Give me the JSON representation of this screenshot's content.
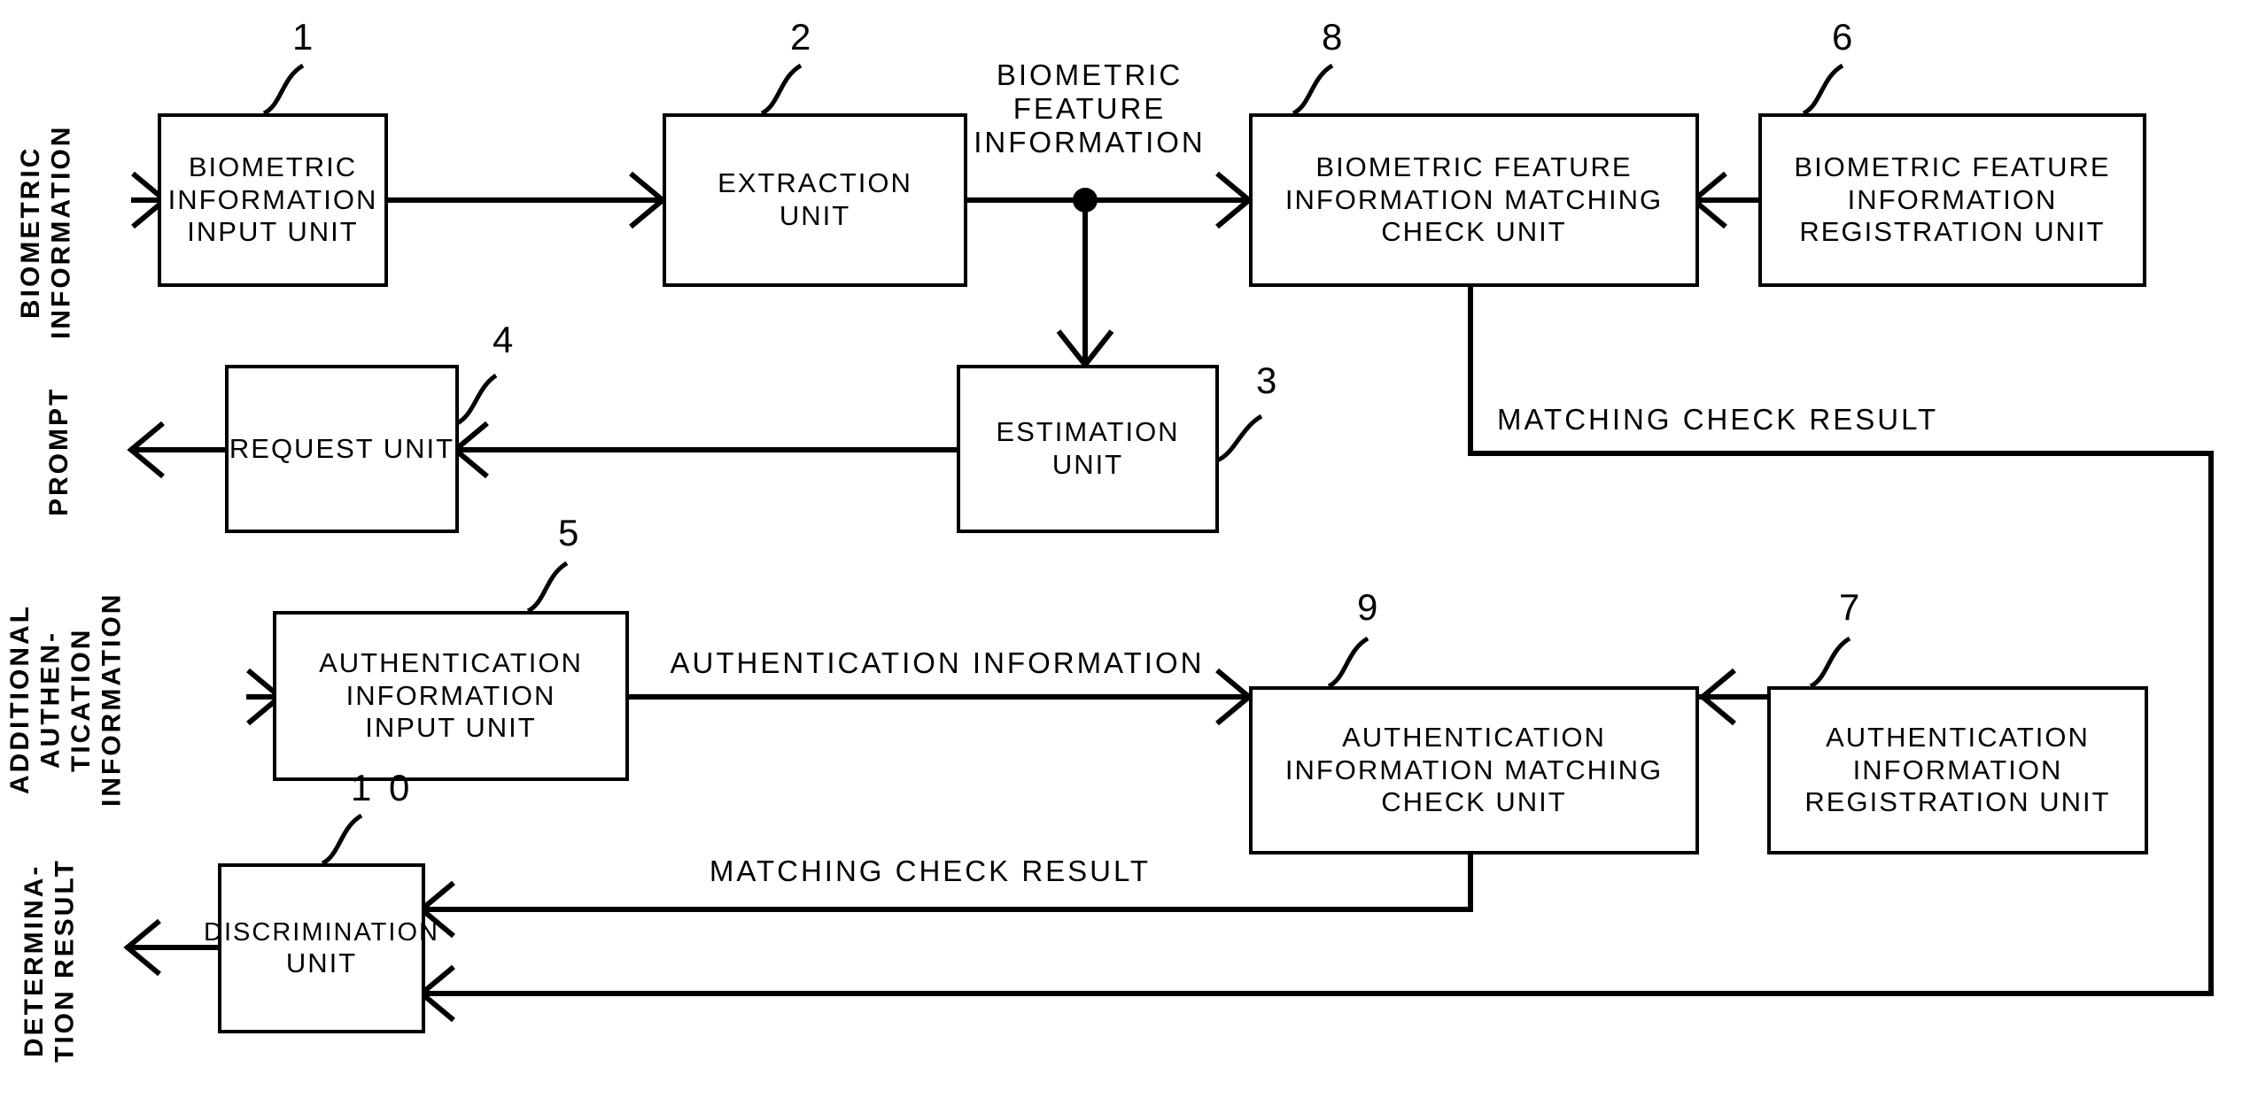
{
  "figure": {
    "kind": "patent-block-diagram",
    "stroke_color": "#000000",
    "background_color": "#ffffff"
  },
  "side_labels": [
    {
      "id": "biometric-information",
      "text": "BIOMETRIC\nINFORMATION"
    },
    {
      "id": "prompt",
      "text": "PROMPT"
    },
    {
      "id": "additional-authentication-information",
      "text": "ADDITIONAL\nAUTHEN-\nTICATION\nINFORMATION"
    },
    {
      "id": "determination-result",
      "text": "DETERMINA-\nTION RESULT"
    }
  ],
  "blocks": [
    {
      "id": "biometric-information-input-unit",
      "ref": "1",
      "lines": [
        "BIOMETRIC",
        "INFORMATION",
        "INPUT UNIT"
      ]
    },
    {
      "id": "extraction-unit",
      "ref": "2",
      "lines": [
        "EXTRACTION",
        "UNIT"
      ]
    },
    {
      "id": "estimation-unit",
      "ref": "3",
      "lines": [
        "ESTIMATION",
        "UNIT"
      ]
    },
    {
      "id": "request-unit",
      "ref": "4",
      "lines": [
        "REQUEST UNIT"
      ]
    },
    {
      "id": "authentication-information-input-unit",
      "ref": "5",
      "lines": [
        "AUTHENTICATION",
        "INFORMATION",
        "INPUT UNIT"
      ]
    },
    {
      "id": "biometric-feature-information-registration-unit",
      "ref": "6",
      "lines": [
        "BIOMETRIC FEATURE",
        "INFORMATION",
        "REGISTRATION UNIT"
      ]
    },
    {
      "id": "authentication-information-registration-unit",
      "ref": "7",
      "lines": [
        "AUTHENTICATION",
        "INFORMATION",
        "REGISTRATION UNIT"
      ]
    },
    {
      "id": "biometric-feature-information-matching-check-unit",
      "ref": "8",
      "lines": [
        "BIOMETRIC FEATURE",
        "INFORMATION MATCHING",
        "CHECK UNIT"
      ]
    },
    {
      "id": "authentication-information-matching-check-unit",
      "ref": "9",
      "lines": [
        "AUTHENTICATION",
        "INFORMATION MATCHING",
        "CHECK UNIT"
      ]
    },
    {
      "id": "discrimination-unit",
      "ref": "1 0",
      "lines": [
        "DISCRIMINATION",
        "UNIT"
      ]
    }
  ],
  "flow_labels": [
    {
      "id": "biometric-feature-information",
      "text": "BIOMETRIC\nFEATURE\nINFORMATION"
    },
    {
      "id": "matching-check-result-top",
      "text": "MATCHING CHECK RESULT"
    },
    {
      "id": "authentication-information",
      "text": "AUTHENTICATION INFORMATION"
    },
    {
      "id": "matching-check-result-bottom",
      "text": "MATCHING CHECK RESULT"
    }
  ],
  "ref_numbers": [
    "1",
    "2",
    "3",
    "4",
    "5",
    "6",
    "7",
    "8",
    "9",
    "1 0"
  ]
}
